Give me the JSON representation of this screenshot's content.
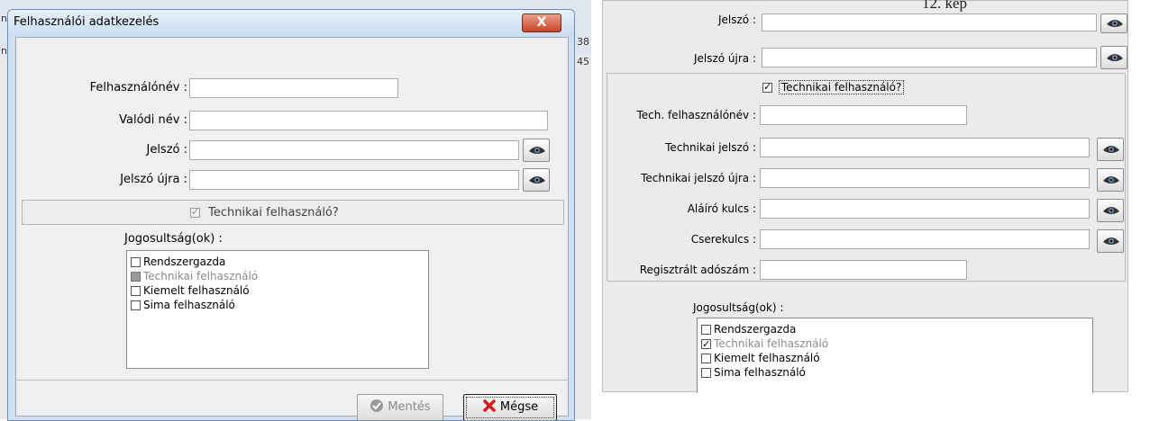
{
  "left_dialog": {
    "title": "Felhasználói adatkezelés",
    "close_label": "X",
    "fields": {
      "username_label": "Felhasználónév :",
      "username_value": "",
      "realname_label": "Valódi név :",
      "realname_value": "",
      "password_label": "Jelszó :",
      "password_value": "",
      "password2_label": "Jelszó újra :",
      "password2_value": ""
    },
    "technical_checkbox": {
      "label": "Technikai felhasználó?",
      "checked": true,
      "disabled": true
    },
    "permissions_label": "Jogosultság(ok) :",
    "permissions": [
      {
        "label": "Rendszergazda",
        "checked": false,
        "state": "normal"
      },
      {
        "label": "Technikai felhasználó",
        "checked": false,
        "state": "disabled"
      },
      {
        "label": "Kiemelt felhasználó",
        "checked": false,
        "state": "normal"
      },
      {
        "label": "Sima felhasználó",
        "checked": false,
        "state": "normal"
      }
    ],
    "buttons": {
      "save": "Mentés",
      "cancel": "Mégse"
    },
    "background_fragments": {
      "left_top": "n",
      "left_mid": "n",
      "right_top": "38",
      "right_mid": "45"
    }
  },
  "right_panel": {
    "caption": "12. kép",
    "top_label_partial": "Jelszó :",
    "password2_label": "Jelszó újra :",
    "technical_checkbox": {
      "label": "Technikai felhasználó?",
      "checked": true
    },
    "fields": [
      {
        "label": "Tech. felhasználónév :",
        "value": "",
        "has_eye": false,
        "short": true
      },
      {
        "label": "Technikai  jelszó :",
        "value": "",
        "has_eye": true,
        "short": false
      },
      {
        "label": "Technikai jelszó újra :",
        "value": "",
        "has_eye": true,
        "short": false
      },
      {
        "label": "Aláíró kulcs :",
        "value": "",
        "has_eye": true,
        "short": false
      },
      {
        "label": "Cserekulcs :",
        "value": "",
        "has_eye": true,
        "short": false
      },
      {
        "label": "Regisztrált adószám :",
        "value": "",
        "has_eye": false,
        "short": true
      }
    ],
    "permissions_label": "Jogosultság(ok) :",
    "permissions": [
      {
        "label": "Rendszergazda",
        "checked": false,
        "state": "normal"
      },
      {
        "label": "Technikai felhasználó",
        "checked": true,
        "state": "disabled"
      },
      {
        "label": "Kiemelt felhasználó",
        "checked": false,
        "state": "normal"
      },
      {
        "label": "Sima felhasználó",
        "checked": false,
        "state": "normal"
      }
    ]
  },
  "icons": {
    "reveal": "eye-icon",
    "save": "checkmark-circle-icon",
    "cancel": "red-x-icon"
  }
}
